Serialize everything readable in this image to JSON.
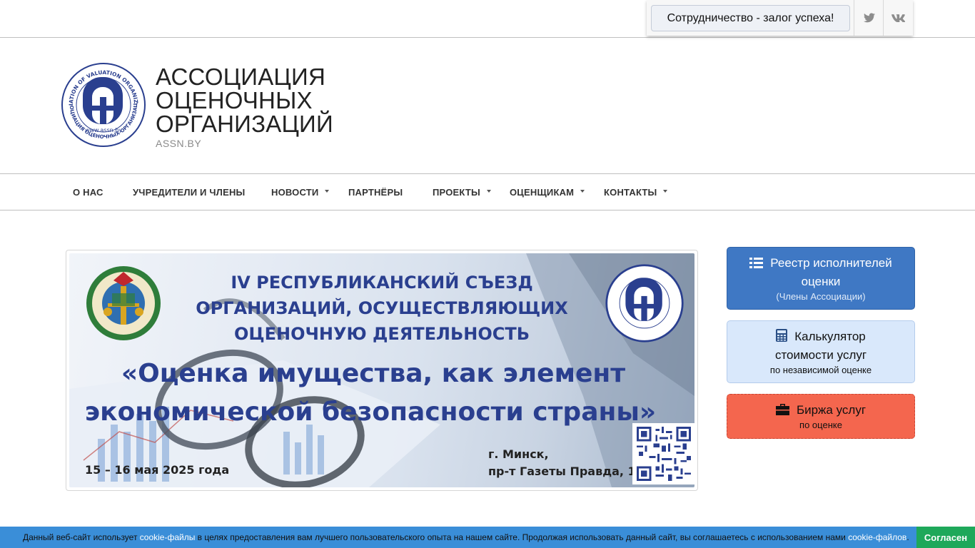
{
  "topbar": {
    "slogan": "Сотрудничество - залог успеха!",
    "social": [
      {
        "name": "twitter-icon",
        "color": "#8d8d8d"
      },
      {
        "name": "vk-icon",
        "color": "#8d8d8d"
      }
    ]
  },
  "header": {
    "logo_text_top": "ASSOCIATION OF VALUATION ORGANIZATIONS",
    "logo_text_bottom": "АССОЦИАЦИЯ ОЦЕНОЧНЫХ ОРГАНИЗАЦИЙ",
    "logo_url_text": "www.assn.by",
    "title_lines": [
      "АССОЦИАЦИЯ",
      "ОЦЕНОЧНЫХ",
      "ОРГАНИЗАЦИЙ"
    ],
    "subtitle": "ASSN.BY",
    "brand_color": "#2a3f8f"
  },
  "nav": {
    "items": [
      {
        "label": "О НАС",
        "dropdown": false
      },
      {
        "label": "УЧРЕДИТЕЛИ И ЧЛЕНЫ",
        "dropdown": false
      },
      {
        "label": "НОВОСТИ",
        "dropdown": true
      },
      {
        "label": "ПАРТНЁРЫ",
        "dropdown": false
      },
      {
        "label": "ПРОЕКТЫ",
        "dropdown": true
      },
      {
        "label": "ОЦЕНЩИКАМ",
        "dropdown": true
      },
      {
        "label": "КОНТАКТЫ",
        "dropdown": true
      }
    ]
  },
  "banner": {
    "lines": [
      "IV РЕСПУБЛИКАНСКИЙ СЪЕЗД",
      "ОРГАНИЗАЦИЙ, ОСУЩЕСТВЛЯЮЩИХ",
      "ОЦЕНОЧНУЮ ДЕЯТЕЛЬНОСТЬ"
    ],
    "quote_lines": [
      "«Оценка имущества, как элемент",
      "экономической безопасности страны»"
    ],
    "date": "15 – 16 мая 2025 года",
    "city_lines": [
      "г. Минск,",
      "пр-т Газеты Правда, 11"
    ]
  },
  "sidebar": {
    "registry": {
      "title": "Реестр исполнителей",
      "title2": "оценки",
      "subtitle": "(Члены Ассоциации)",
      "color": "#3f78c4"
    },
    "calculator": {
      "title": "Калькулятор",
      "title2": "стоимости услуг",
      "subtitle": "по независимой оценке",
      "color": "#d9e8fb"
    },
    "market": {
      "title": "Биржа услуг",
      "subtitle": "по оценке",
      "color": "#f4664e"
    }
  },
  "cookie": {
    "text_before": "Данный веб-сайт использует ",
    "link1": "cookie-файлы",
    "text_middle": " в целях предоставления вам лучшего пользовательского опыта на нашем сайте. Продолжая использовать данный сайт, вы соглашаетесь с использованием нами ",
    "link2": "cookie-файлов",
    "text_after": ".",
    "accept": "Согласен"
  }
}
